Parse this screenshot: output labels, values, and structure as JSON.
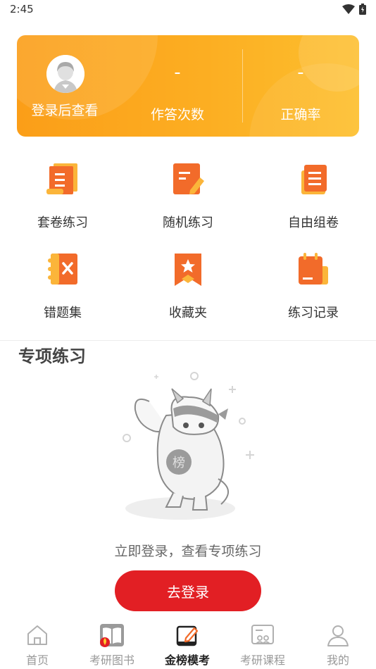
{
  "status_bar": {
    "time": "2:45"
  },
  "stats": {
    "login_prompt": "登录后查看",
    "answer_count_value": "-",
    "answer_count_label": "作答次数",
    "accuracy_value": "-",
    "accuracy_label": "正确率"
  },
  "grid": {
    "items": [
      {
        "label": "套卷练习",
        "icon": "paper-set-icon"
      },
      {
        "label": "随机练习",
        "icon": "random-practice-icon"
      },
      {
        "label": "自由组卷",
        "icon": "custom-paper-icon"
      },
      {
        "label": "错题集",
        "icon": "wrong-questions-icon"
      },
      {
        "label": "收藏夹",
        "icon": "favorites-icon"
      },
      {
        "label": "练习记录",
        "icon": "practice-record-icon"
      }
    ]
  },
  "section": {
    "title": "专项练习",
    "empty_text": "立即登录，查看专项练习",
    "login_button": "去登录"
  },
  "bottom_nav": {
    "items": [
      {
        "label": "首页",
        "icon": "home-icon"
      },
      {
        "label": "考研图书",
        "icon": "book-icon"
      },
      {
        "label": "金榜模考",
        "icon": "exam-edit-icon"
      },
      {
        "label": "考研课程",
        "icon": "course-icon"
      },
      {
        "label": "我的",
        "icon": "profile-icon"
      }
    ],
    "active_index": 2
  },
  "colors": {
    "accent_orange": "#fb9e18",
    "accent_yellow": "#fdbf2e",
    "button_red": "#e21f24",
    "icon_orange": "#f26b2a"
  }
}
